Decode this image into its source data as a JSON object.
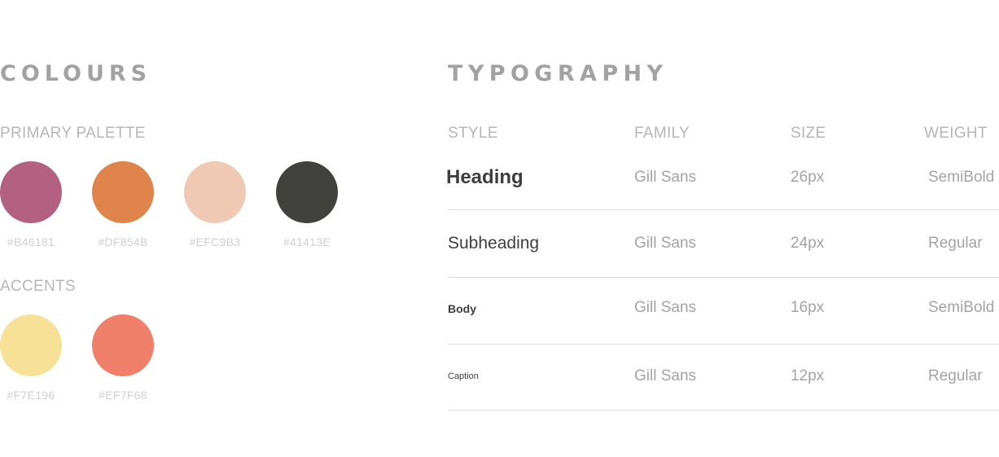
{
  "colours": {
    "title": "COLOURS",
    "primary_label": "PRIMARY PALETTE",
    "primary": [
      {
        "hex": "#B46181",
        "color": "#B46181"
      },
      {
        "hex": "#DF854B",
        "color": "#DF854B"
      },
      {
        "hex": "#EFC9B3",
        "color": "#EFC9B3"
      },
      {
        "hex": "#41413E",
        "color": "#41413E"
      }
    ],
    "accents_label": "ACCENTS",
    "accents": [
      {
        "hex": "#F7E196",
        "color": "#F7E196"
      },
      {
        "hex": "#EF7F68",
        "color": "#EF7F68"
      }
    ]
  },
  "typography": {
    "title": "TYPOGRAPHY",
    "headers": {
      "style": "STYLE",
      "family": "FAMILY",
      "size": "SIZE",
      "weight": "WEIGHT"
    },
    "rows": [
      {
        "style": "Heading",
        "family": "Gill Sans",
        "size": "26px",
        "weight": "SemiBold"
      },
      {
        "style": "Subheading",
        "family": "Gill Sans",
        "size": "24px",
        "weight": "Regular"
      },
      {
        "style": "Body",
        "family": "Gill Sans",
        "size": "16px",
        "weight": "SemiBold"
      },
      {
        "style": "Caption",
        "family": "Gill Sans",
        "size": "12px",
        "weight": "Regular"
      }
    ]
  }
}
